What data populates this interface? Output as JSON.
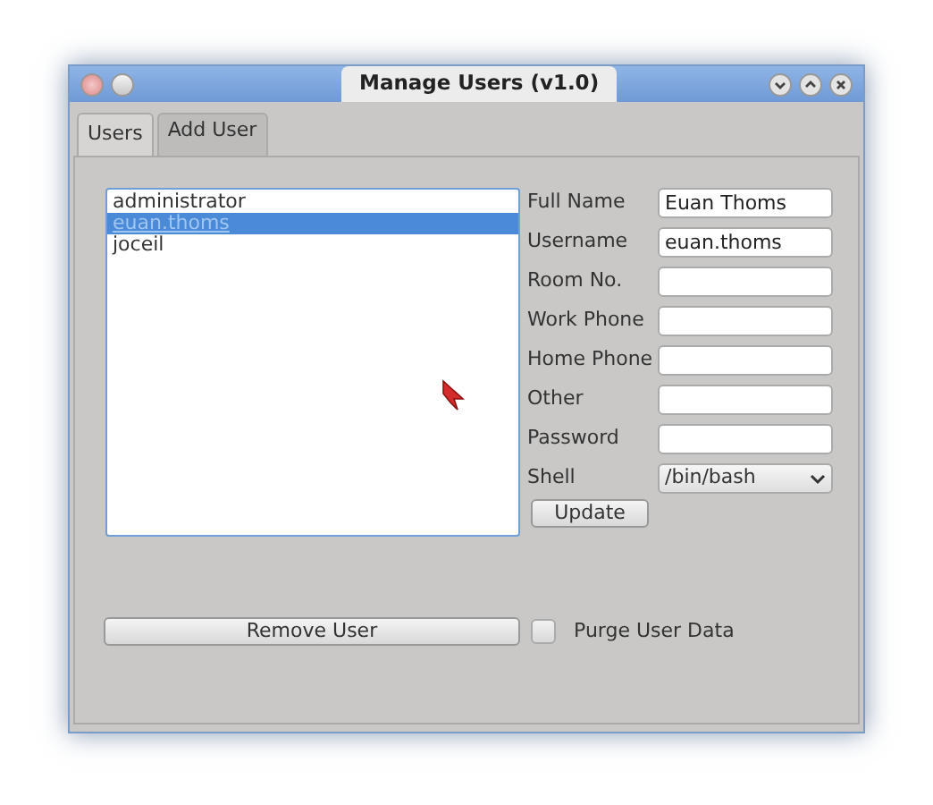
{
  "window": {
    "title": "Manage Users (v1.0)"
  },
  "tabs": [
    {
      "label": "Users",
      "selected": true
    },
    {
      "label": "Add User",
      "selected": false
    }
  ],
  "user_list": [
    {
      "label": "administrator",
      "selected": false
    },
    {
      "label": "euan.thoms",
      "selected": true
    },
    {
      "label": "joceil",
      "selected": false
    }
  ],
  "fields": [
    {
      "label": "Full Name",
      "kind": "text",
      "value": "Euan Thoms"
    },
    {
      "label": "Username",
      "kind": "text",
      "value": "euan.thoms"
    },
    {
      "label": "Room No.",
      "kind": "text"
    },
    {
      "label": "Work Phone",
      "kind": "text"
    },
    {
      "label": "Home Phone",
      "kind": "text"
    },
    {
      "label": "Other",
      "kind": "text"
    },
    {
      "label": "Password",
      "kind": "text"
    },
    {
      "label": "Shell",
      "kind": "select",
      "value": "/bin/bash"
    }
  ],
  "update_button": "Update",
  "remove_button": "Remove User",
  "purge": {
    "label": "Purge User Data",
    "checked": false
  }
}
